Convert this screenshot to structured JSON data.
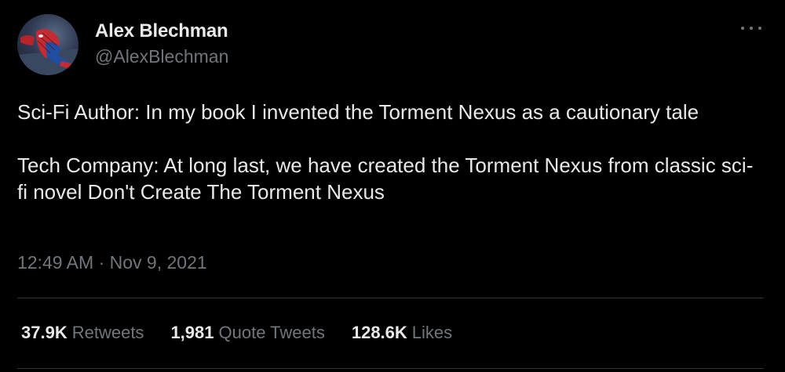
{
  "author": {
    "name": "Alex Blechman",
    "handle": "@AlexBlechman",
    "avatar_icon": "spiderman-avatar"
  },
  "menu": {
    "icon": "more-icon"
  },
  "tweet": {
    "paragraphs": [
      "Sci-Fi Author: In my book I invented the Torment Nexus as a cautionary tale",
      "Tech Company: At long last, we have created the Torment Nexus from classic sci-fi novel Don't Create The Torment Nexus"
    ]
  },
  "meta": {
    "time": "12:49 AM",
    "separator": "·",
    "date": "Nov 9, 2021"
  },
  "stats": [
    {
      "value": "37.9K",
      "label": "Retweets"
    },
    {
      "value": "1,981",
      "label": "Quote Tweets"
    },
    {
      "value": "128.6K",
      "label": "Likes"
    }
  ],
  "colors": {
    "background": "#000000",
    "primary_text": "#e7e9ea",
    "secondary_text": "#71767b",
    "divider": "#2f3336"
  }
}
